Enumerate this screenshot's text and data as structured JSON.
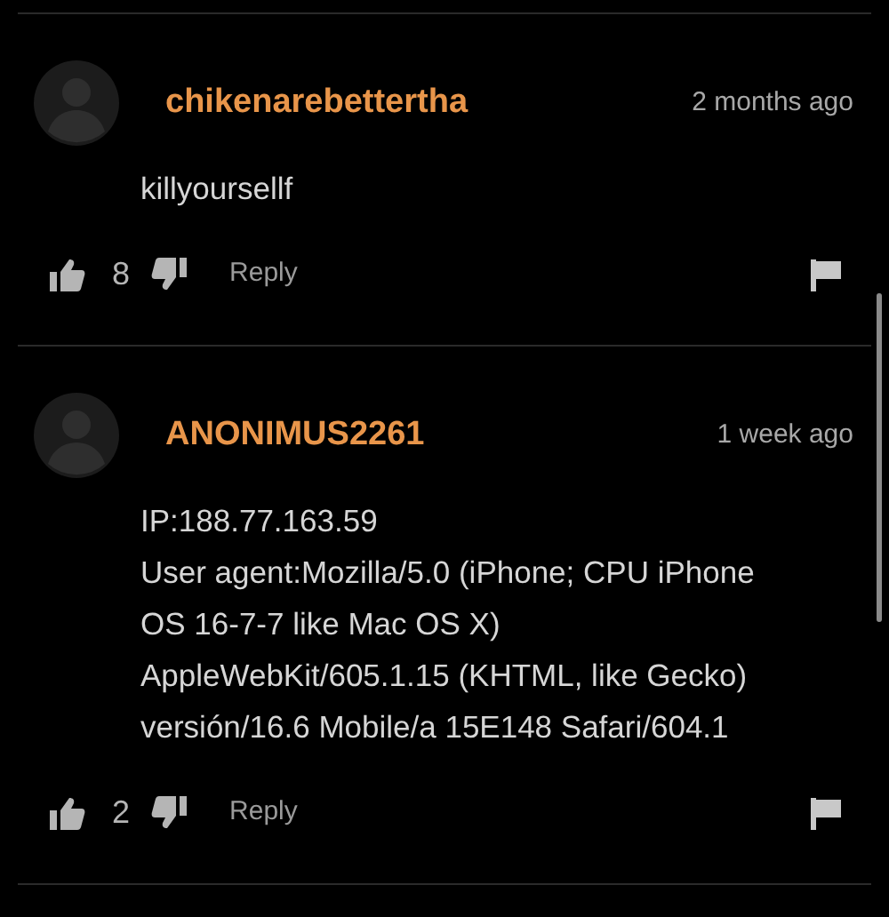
{
  "comments": [
    {
      "username": "chikenarebettertha",
      "time": "2 months ago",
      "body": [
        "killyoursellf"
      ],
      "likes": "8",
      "reply": "Reply"
    },
    {
      "username": "ANONIMUS2261",
      "time": "1 week ago",
      "body": [
        "IP:188.77.163.59",
        "User agent:Mozilla/5.0 (iPhone; CPU iPhone",
        "OS 16-7-7 like Mac OS X)",
        "AppleWebKit/605.1.15 (KHTML, like Gecko)",
        "versión/16.6 Mobile/a 15E148 Safari/604.1"
      ],
      "likes": "2",
      "reply": "Reply"
    }
  ]
}
